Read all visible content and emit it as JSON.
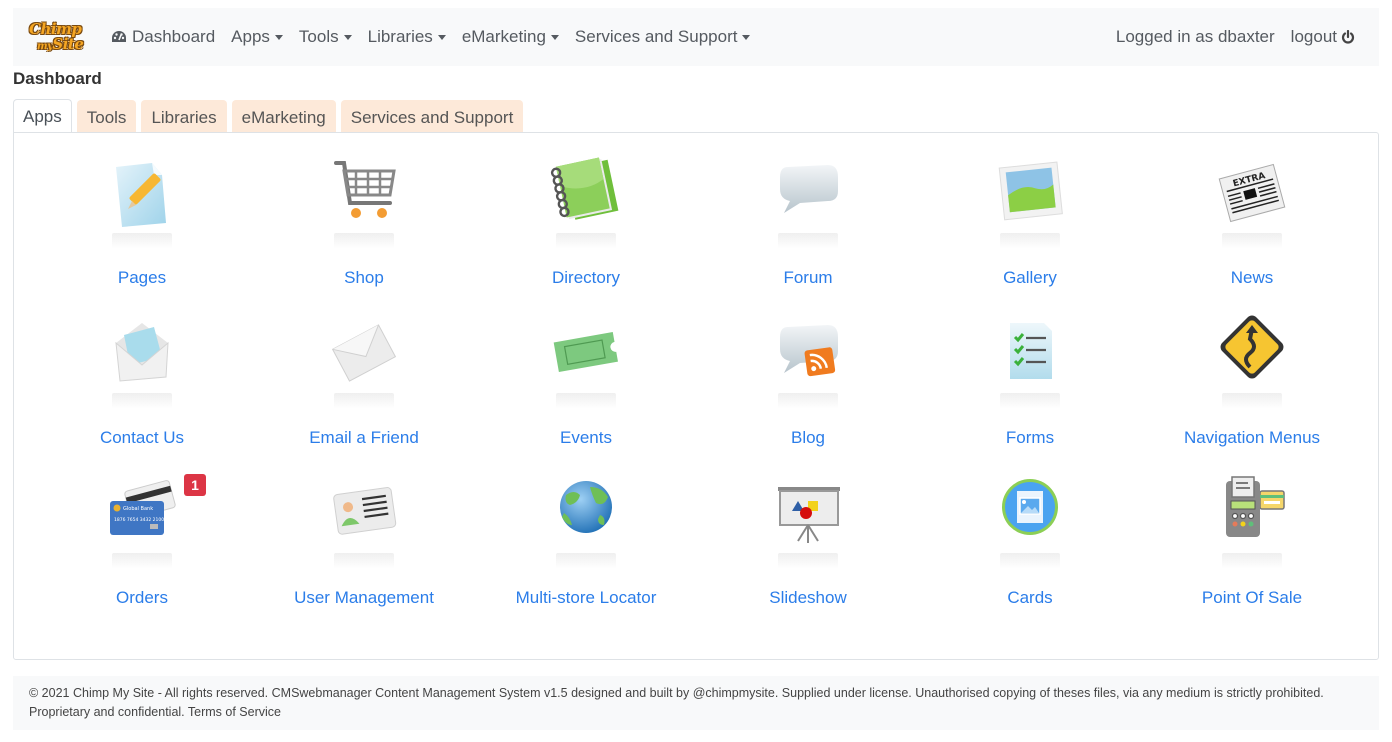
{
  "navbar": {
    "logo_line1": "Chimp",
    "logo_line2_small": "my",
    "logo_line2": "Site",
    "links": [
      {
        "label": "Dashboard",
        "icon": "dashboard-icon",
        "dropdown": false
      },
      {
        "label": "Apps",
        "dropdown": true
      },
      {
        "label": "Tools",
        "dropdown": true
      },
      {
        "label": "Libraries",
        "dropdown": true
      },
      {
        "label": "eMarketing",
        "dropdown": true
      },
      {
        "label": "Services and Support",
        "dropdown": true
      }
    ],
    "user_text": "Logged in as dbaxter",
    "logout_label": "logout",
    "logout_icon": "power-icon"
  },
  "page": {
    "title": "Dashboard"
  },
  "tabs": [
    {
      "label": "Apps",
      "active": true
    },
    {
      "label": "Tools",
      "active": false
    },
    {
      "label": "Libraries",
      "active": false
    },
    {
      "label": "eMarketing",
      "active": false
    },
    {
      "label": "Services and Support",
      "active": false
    }
  ],
  "apps": [
    {
      "label": "Pages",
      "icon": "pages-icon"
    },
    {
      "label": "Shop",
      "icon": "shopping-cart-icon"
    },
    {
      "label": "Directory",
      "icon": "notebook-icon"
    },
    {
      "label": "Forum",
      "icon": "speech-bubble-icon"
    },
    {
      "label": "Gallery",
      "icon": "picture-icon"
    },
    {
      "label": "News",
      "icon": "newspaper-icon"
    },
    {
      "label": "Contact Us",
      "icon": "open-envelope-icon"
    },
    {
      "label": "Email a Friend",
      "icon": "envelope-icon"
    },
    {
      "label": "Events",
      "icon": "ticket-icon"
    },
    {
      "label": "Blog",
      "icon": "rss-bubble-icon"
    },
    {
      "label": "Forms",
      "icon": "checklist-icon"
    },
    {
      "label": "Navigation Menus",
      "icon": "road-sign-icon"
    },
    {
      "label": "Orders",
      "icon": "credit-card-icon",
      "badge": "1"
    },
    {
      "label": "User Management",
      "icon": "id-card-icon"
    },
    {
      "label": "Multi-store Locator",
      "icon": "globe-icon"
    },
    {
      "label": "Slideshow",
      "icon": "presentation-board-icon"
    },
    {
      "label": "Cards",
      "icon": "image-card-icon"
    },
    {
      "label": "Point Of Sale",
      "icon": "payment-terminal-icon"
    }
  ],
  "colors": {
    "link": "#2b7de9",
    "tab_inactive_bg": "#fde9d9",
    "badge": "#dc3545",
    "navbar_bg": "#f8f9fa"
  },
  "footer": {
    "text": "© 2021 Chimp My Site - All rights reserved. CMSwebmanager Content Management System v1.5 designed and built by @chimpmysite. Supplied under license. Unauthorised copying of theses files, via any medium is strictly prohibited. Proprietary and confidential.",
    "terms_link": "Terms of Service"
  }
}
